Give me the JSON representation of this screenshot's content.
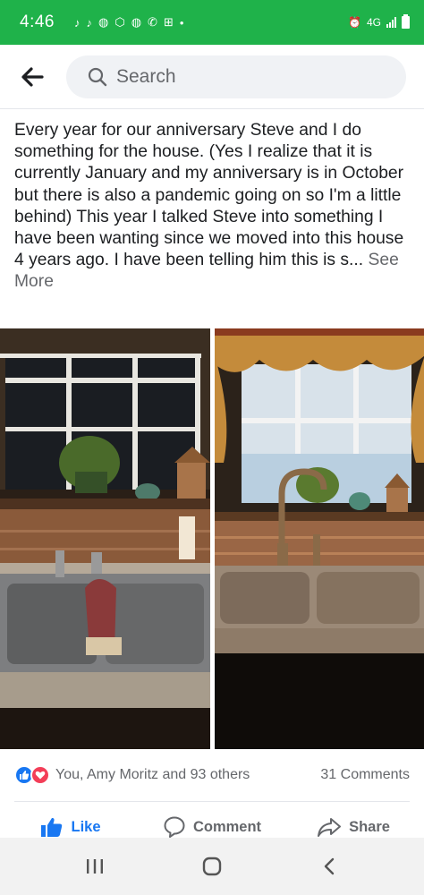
{
  "status_bar": {
    "time": "4:46",
    "network_label": "4G",
    "notification_icons": [
      "tiktok-icon",
      "tiktok-icon",
      "globe-icon",
      "box-icon",
      "globe-icon",
      "wifi-call-icon",
      "grid-icon",
      "dot-icon"
    ]
  },
  "header": {
    "search_placeholder": "Search"
  },
  "post": {
    "text": "Every year for our anniversary Steve and I do something for the house.  (Yes I realize that it is currently January and my anniversary is in October but there is also a pandemic going on so I'm a little behind)  This year I talked Steve into something I have been wanting since we moved into this house 4 years ago.  I have been telling him this is s... ",
    "see_more": "See More",
    "photos": [
      "before-kitchen-sink-photo",
      "after-kitchen-sink-photo"
    ]
  },
  "engagement": {
    "reactions": [
      "like",
      "love"
    ],
    "names": "You, Amy Moritz and 93 others",
    "comments": "31 Comments"
  },
  "actions": {
    "like": "Like",
    "comment": "Comment",
    "share": "Share"
  },
  "colors": {
    "status_green": "#1fb24a",
    "fb_blue": "#1877f2",
    "love_red": "#f33e58"
  }
}
